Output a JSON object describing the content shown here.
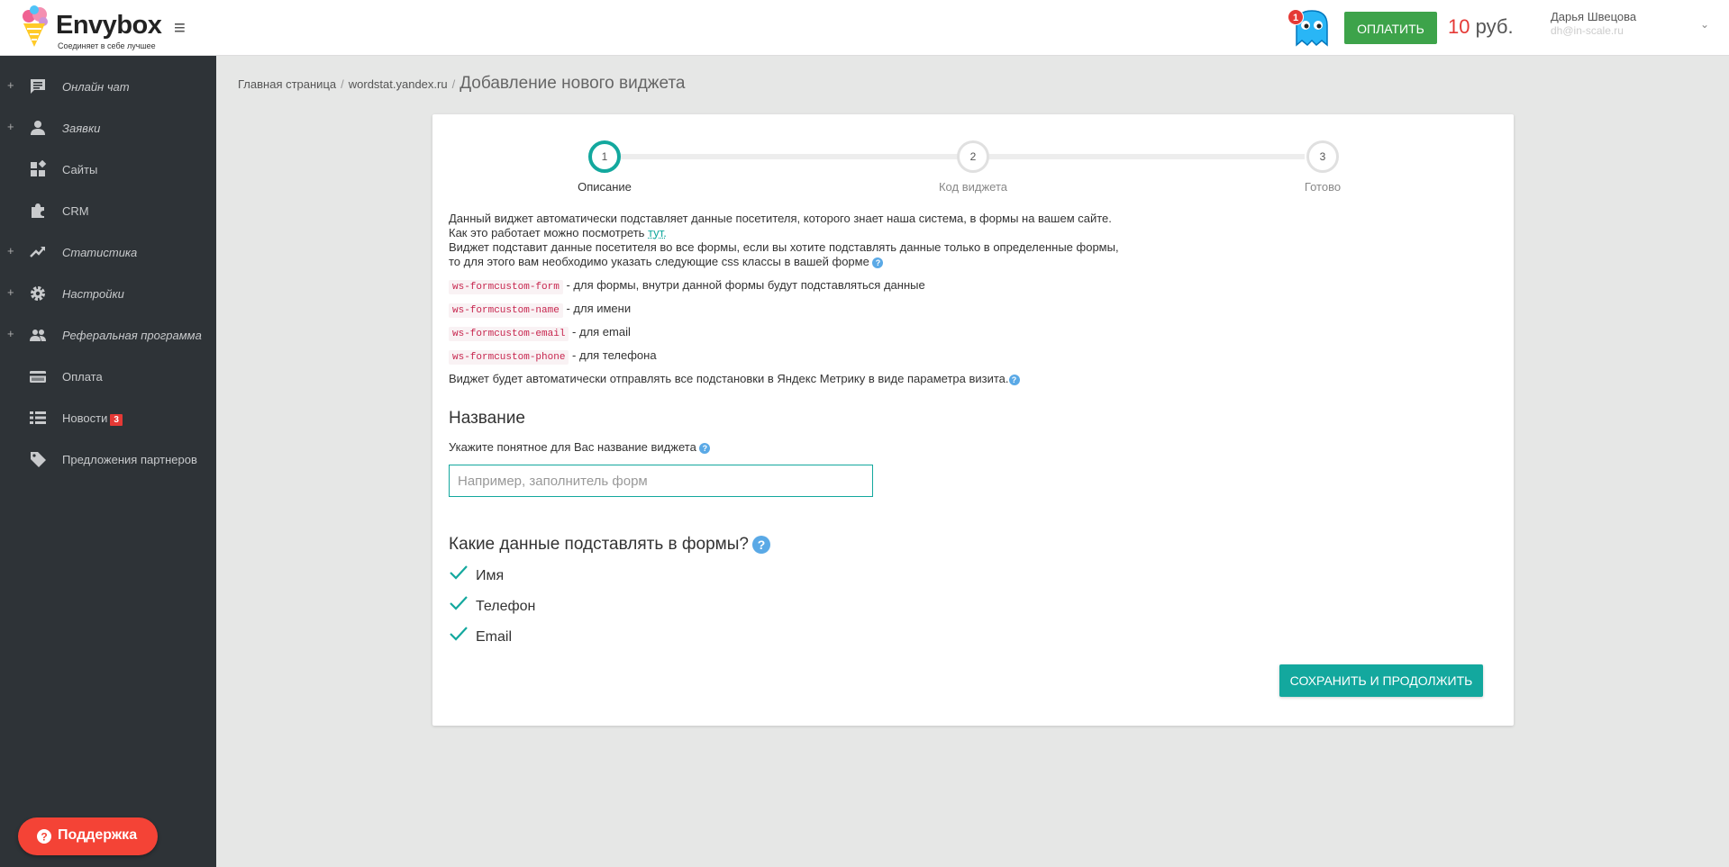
{
  "header": {
    "logo_name": "Envybox",
    "logo_tagline": "Соединяет в себе лучшее",
    "notification_count": "1",
    "pay_button": "ОПЛАТИТЬ",
    "balance_amount": "10",
    "balance_currency": "руб.",
    "user_name": "Дарья Швецова",
    "user_email": "dh@in-scale.ru"
  },
  "sidebar": {
    "items": [
      {
        "label": "Онлайн чат",
        "icon": "chat-icon",
        "expandable": true
      },
      {
        "label": "Заявки",
        "icon": "person-icon",
        "expandable": true
      },
      {
        "label": "Сайты",
        "icon": "widgets-icon",
        "expandable": false
      },
      {
        "label": "CRM",
        "icon": "puzzle-icon",
        "expandable": false
      },
      {
        "label": "Статистика",
        "icon": "trending-up-icon",
        "expandable": true
      },
      {
        "label": "Настройки",
        "icon": "gear-icon",
        "expandable": true
      },
      {
        "label": "Реферальная программа",
        "icon": "people-icon",
        "expandable": true
      },
      {
        "label": "Оплата",
        "icon": "credit-card-icon",
        "expandable": false
      },
      {
        "label": "Новости",
        "icon": "list-icon",
        "expandable": false,
        "badge": "3"
      },
      {
        "label": "Предложения партнеров",
        "icon": "tag-icon",
        "expandable": false
      }
    ],
    "support_label": "Поддержка"
  },
  "breadcrumb": {
    "home": "Главная страница",
    "site": "wordstat.yandex.ru",
    "current": "Добавление нового виджета"
  },
  "stepper": {
    "steps": [
      {
        "number": "1",
        "label": "Описание",
        "active": true
      },
      {
        "number": "2",
        "label": "Код виджета",
        "active": false
      },
      {
        "number": "3",
        "label": "Готово",
        "active": false
      }
    ]
  },
  "description": {
    "line1": "Данный виджет автоматически подставляет данные посетителя, которого знает наша система, в формы на вашем сайте.",
    "line2_prefix": "Как это работает можно посмотреть",
    "line2_link": "тут.",
    "line3": "Виджет подставит данные посетителя во все формы, если вы хотите подставлять данные только в определенные формы,",
    "line4": "то для этого вам необходимо указать следующие css классы в вашей форме",
    "classes": [
      {
        "code": "ws-formcustom-form",
        "text": "- для формы, внутри данной формы будут подставляться данные"
      },
      {
        "code": "ws-formcustom-name",
        "text": "- для имени"
      },
      {
        "code": "ws-formcustom-email",
        "text": "- для email"
      },
      {
        "code": "ws-formcustom-phone",
        "text": "- для телефона"
      }
    ],
    "metrika": "Виджет будет автоматически отправлять все подстановки в Яндекс Метрику в виде параметра визита."
  },
  "name_section": {
    "title": "Название",
    "hint": "Укажите понятное для Вас название виджета",
    "input_value": "",
    "input_placeholder": "Например, заполнитель форм"
  },
  "data_section": {
    "title": "Какие данные подставлять в формы?",
    "options": [
      {
        "label": "Имя",
        "checked": true
      },
      {
        "label": "Телефон",
        "checked": true
      },
      {
        "label": "Email",
        "checked": true
      }
    ]
  },
  "save_button": "СОХРАНИТЬ И ПРОДОЛЖИТЬ",
  "colors": {
    "accent": "#13a89e",
    "pay_green": "#3da34a",
    "sidebar_bg": "#2e3337",
    "danger_red": "#e53935",
    "help_blue": "#5aa9e6"
  }
}
